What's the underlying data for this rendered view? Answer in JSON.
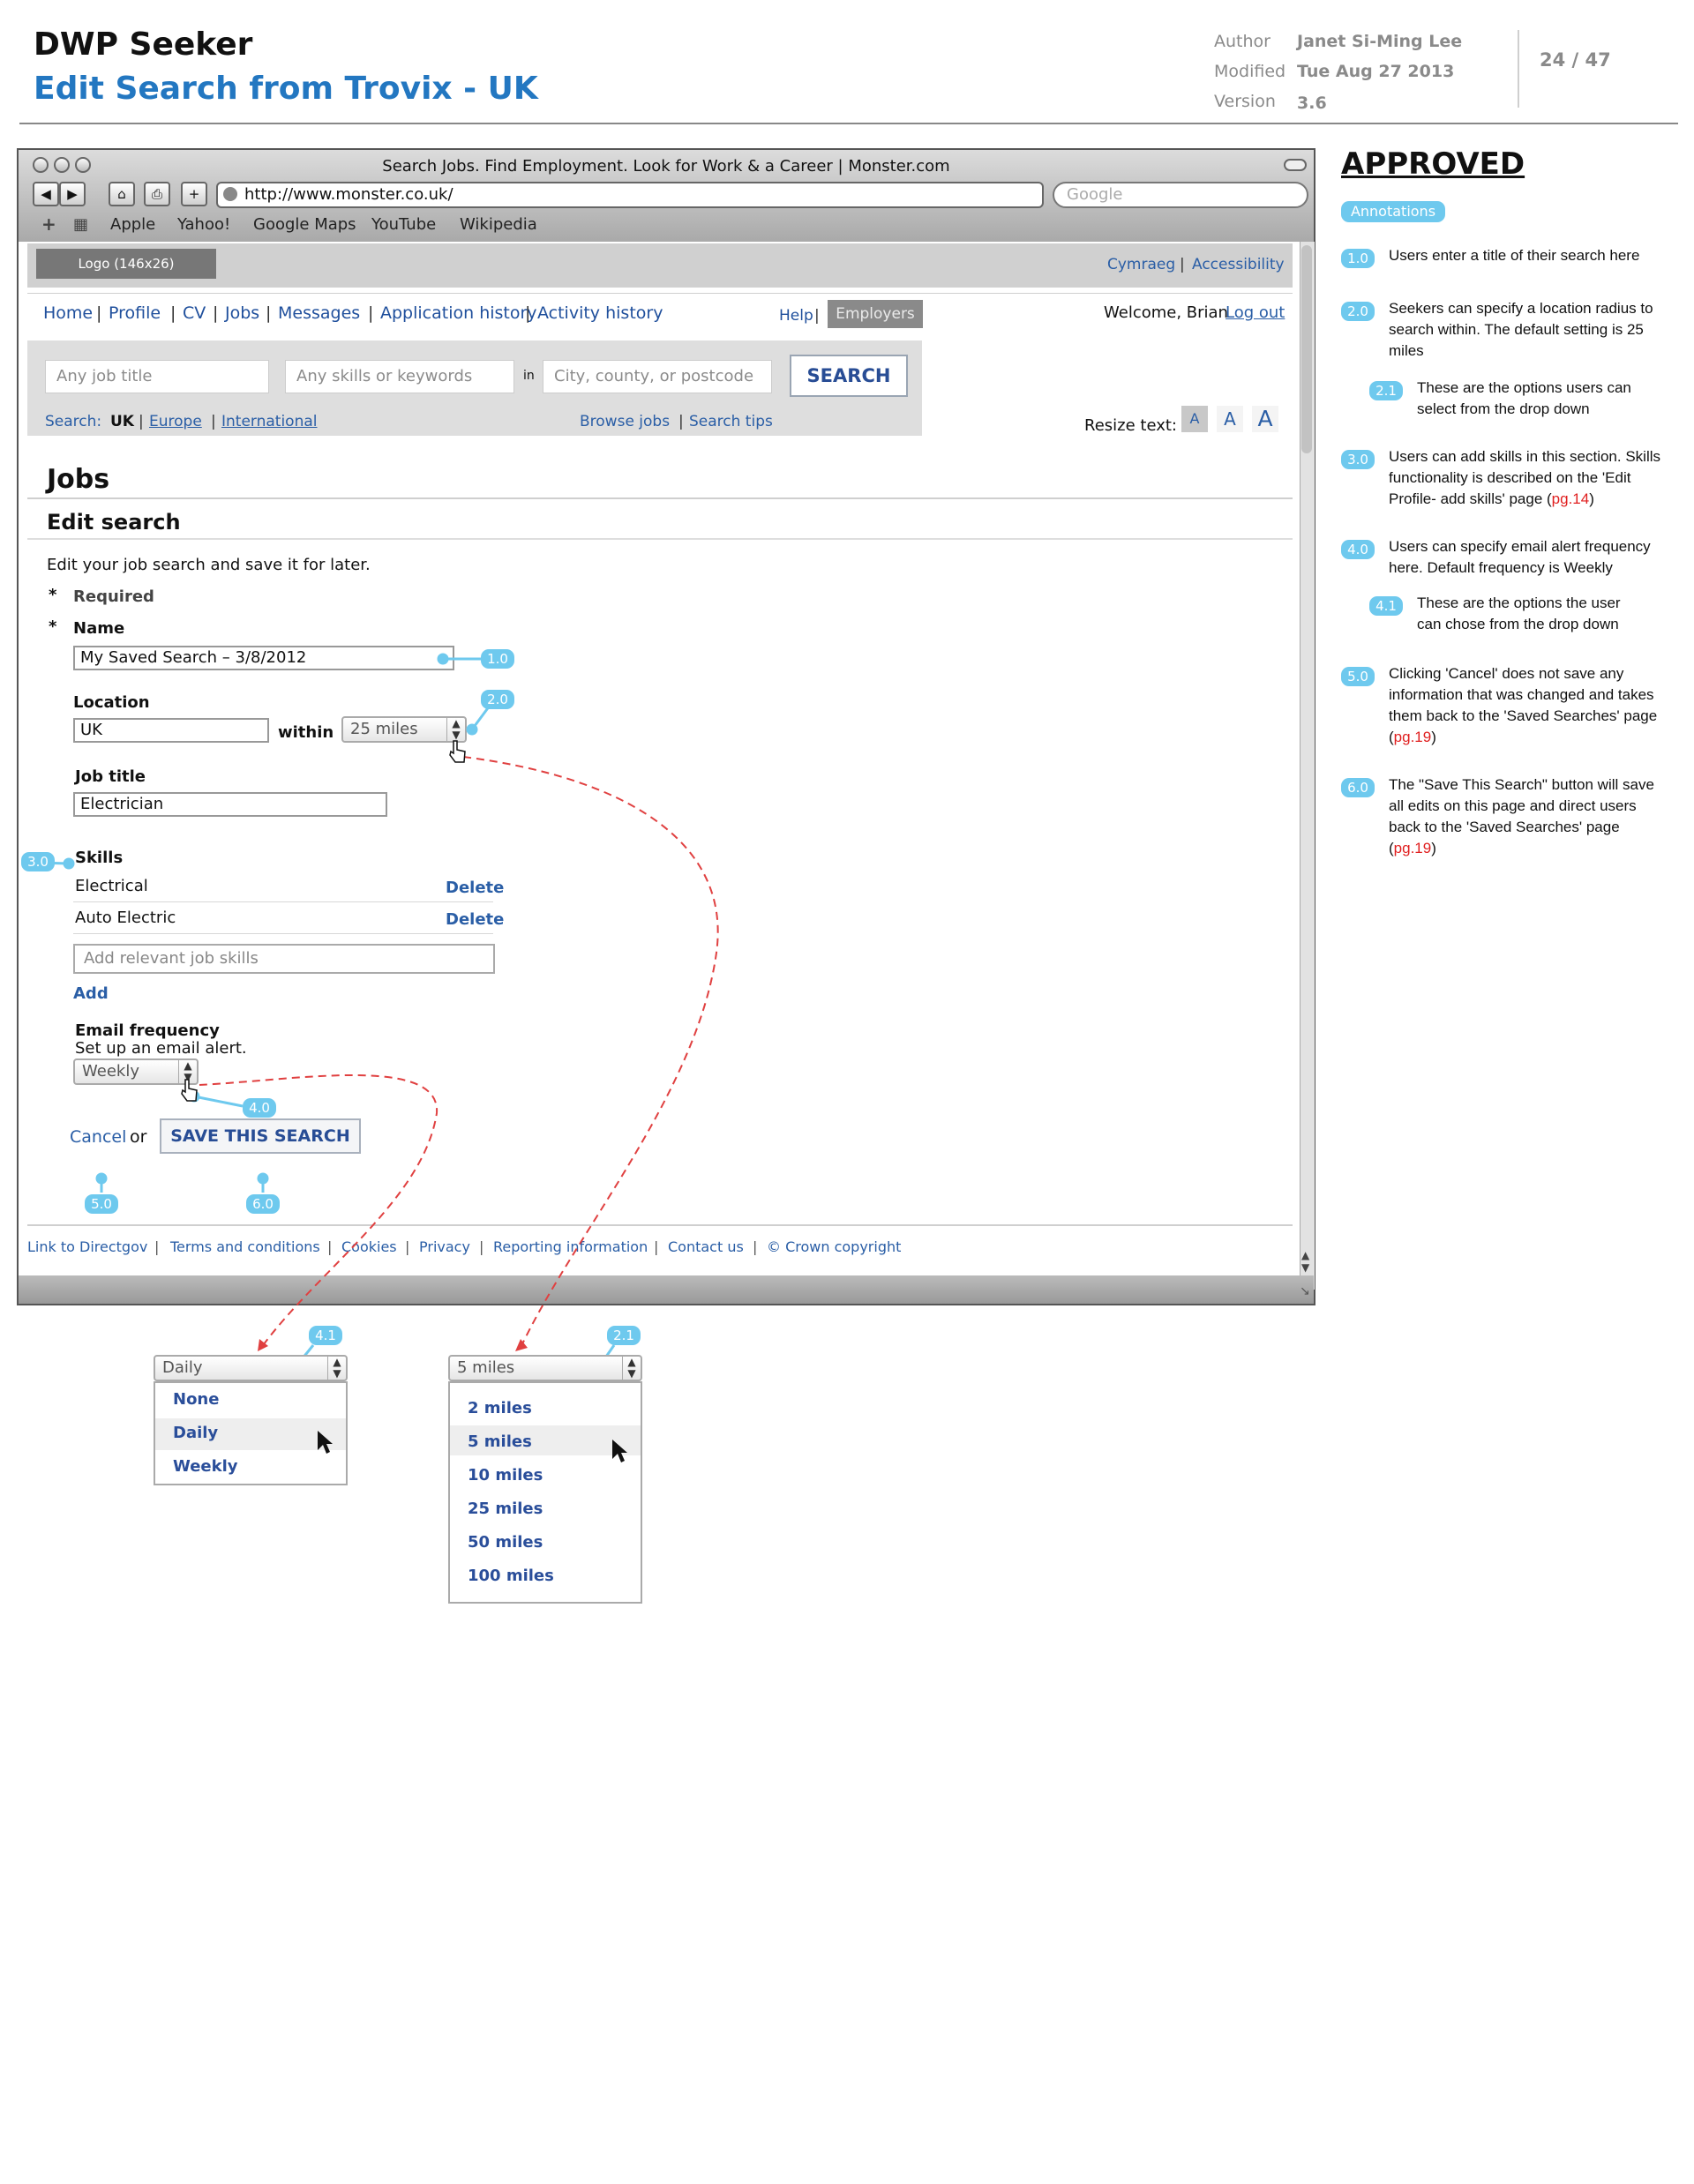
{
  "doc": {
    "title": "DWP Seeker",
    "subtitle": "Edit Search from Trovix - UK",
    "author_label": "Author",
    "author": "Janet Si-Ming Lee",
    "modified_label": "Modified",
    "modified": "Tue Aug 27 2013",
    "version_label": "Version",
    "version": "3.6",
    "page": "24 / 47"
  },
  "browser": {
    "window_title": "Search Jobs. Find Employment. Look for Work & a Career | Monster.com",
    "url": "http://www.monster.co.uk/",
    "search_placeholder": "Google",
    "bookmarks": [
      "Apple",
      "Yahoo!",
      "Google Maps",
      "YouTube",
      "Wikipedia"
    ]
  },
  "site": {
    "logo": "Logo (146x26)",
    "util_links": [
      "Cymraeg",
      "Accessibility"
    ],
    "nav": [
      "Home",
      "Profile",
      "CV",
      "Jobs",
      "Messages",
      "Application history",
      "Activity history"
    ],
    "help": "Help",
    "employers": "Employers",
    "welcome": "Welcome, Brian",
    "logout": "Log out",
    "search": {
      "job_title_placeholder": "Any job title",
      "skills_placeholder": "Any skills or keywords",
      "in": "in",
      "location_placeholder": "City, county, or postcode",
      "button": "SEARCH",
      "search_label": "Search:",
      "uk": "UK",
      "europe": "Europe",
      "international": "International",
      "browse_jobs": "Browse jobs",
      "search_tips": "Search tips"
    },
    "resize_label": "Resize text:",
    "resize_a": "A",
    "page_heading": "Jobs",
    "section_heading": "Edit search",
    "intro": "Edit your job search and save it for later.",
    "required_star": "*",
    "required": "Required",
    "name_label": "Name",
    "name_value": "My Saved Search – 3/8/2012",
    "location_label": "Location",
    "location_value": "UK",
    "within": "within",
    "radius_value": "25 miles",
    "job_title_label": "Job title",
    "job_title_value": "Electrician",
    "skills_label": "Skills",
    "skills": [
      {
        "name": "Electrical",
        "action": "Delete"
      },
      {
        "name": "Auto Electric",
        "action": "Delete"
      }
    ],
    "add_skills_placeholder": "Add relevant job skills",
    "add": "Add",
    "email_label": "Email frequency",
    "email_sub": "Set up an email alert.",
    "email_value": "Weekly",
    "cancel": "Cancel",
    "or": "or",
    "save": "SAVE THIS SEARCH",
    "footer": [
      "Link to Directgov",
      "Terms and conditions",
      "Cookies",
      "Privacy",
      "Reporting information",
      "Contact us",
      "© Crown copyright"
    ]
  },
  "annotations": {
    "approved": "APPROVED",
    "heading": "Annotations",
    "items": [
      {
        "id": "1.0",
        "text": "Users enter a title of their search here"
      },
      {
        "id": "2.0",
        "text": "Seekers can specify a location radius to search within. The default setting is 25 miles"
      },
      {
        "id": "2.1",
        "text": "These are the options users can select from the drop down"
      },
      {
        "id": "3.0",
        "text": "Users can add skills in this section. Skills functionality is described on the 'Edit Profile- add skills' page (",
        "ref": "pg.14",
        "after": ")"
      },
      {
        "id": "4.0",
        "text": "Users can specify email alert frequency here. Default frequency is Weekly"
      },
      {
        "id": "4.1",
        "text": "These are the options the user can chose from the drop down"
      },
      {
        "id": "5.0",
        "text": "Clicking 'Cancel' does not save any information that was changed and takes them back to the 'Saved Searches' page (",
        "ref": "pg.19",
        "after": ")"
      },
      {
        "id": "6.0",
        "text": "The \"Save This Search\" button will save all edits on this page and direct users back to the 'Saved Searches' page (",
        "ref": "pg.19",
        "after": ")"
      }
    ]
  },
  "dropdowns": {
    "email": {
      "selected": "Daily",
      "options": [
        "None",
        "Daily",
        "Weekly"
      ],
      "highlighted": "Daily"
    },
    "radius": {
      "selected": "5 miles",
      "options": [
        "2 miles",
        "5 miles",
        "10 miles",
        "25 miles",
        "50 miles",
        "100 miles"
      ],
      "highlighted": "5 miles"
    }
  },
  "colors": {
    "accent": "#2377c1",
    "annotation": "#6ec9ee",
    "link": "#2a5ea6",
    "connector": "#e04040"
  }
}
